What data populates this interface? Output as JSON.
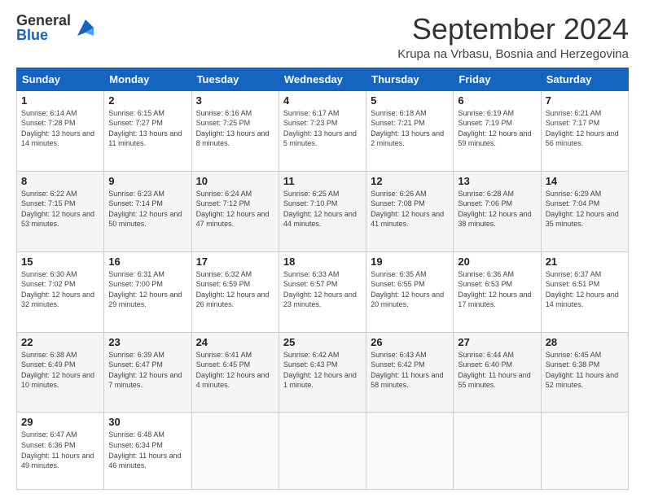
{
  "header": {
    "logo": {
      "general": "General",
      "blue": "Blue"
    },
    "title": "September 2024",
    "location": "Krupa na Vrbasu, Bosnia and Herzegovina"
  },
  "weekdays": [
    "Sunday",
    "Monday",
    "Tuesday",
    "Wednesday",
    "Thursday",
    "Friday",
    "Saturday"
  ],
  "weeks": [
    [
      {
        "day": "1",
        "sunrise": "6:14 AM",
        "sunset": "7:28 PM",
        "daylight": "13 hours and 14 minutes."
      },
      {
        "day": "2",
        "sunrise": "6:15 AM",
        "sunset": "7:27 PM",
        "daylight": "13 hours and 11 minutes."
      },
      {
        "day": "3",
        "sunrise": "6:16 AM",
        "sunset": "7:25 PM",
        "daylight": "13 hours and 8 minutes."
      },
      {
        "day": "4",
        "sunrise": "6:17 AM",
        "sunset": "7:23 PM",
        "daylight": "13 hours and 5 minutes."
      },
      {
        "day": "5",
        "sunrise": "6:18 AM",
        "sunset": "7:21 PM",
        "daylight": "13 hours and 2 minutes."
      },
      {
        "day": "6",
        "sunrise": "6:19 AM",
        "sunset": "7:19 PM",
        "daylight": "12 hours and 59 minutes."
      },
      {
        "day": "7",
        "sunrise": "6:21 AM",
        "sunset": "7:17 PM",
        "daylight": "12 hours and 56 minutes."
      }
    ],
    [
      {
        "day": "8",
        "sunrise": "6:22 AM",
        "sunset": "7:15 PM",
        "daylight": "12 hours and 53 minutes."
      },
      {
        "day": "9",
        "sunrise": "6:23 AM",
        "sunset": "7:14 PM",
        "daylight": "12 hours and 50 minutes."
      },
      {
        "day": "10",
        "sunrise": "6:24 AM",
        "sunset": "7:12 PM",
        "daylight": "12 hours and 47 minutes."
      },
      {
        "day": "11",
        "sunrise": "6:25 AM",
        "sunset": "7:10 PM",
        "daylight": "12 hours and 44 minutes."
      },
      {
        "day": "12",
        "sunrise": "6:26 AM",
        "sunset": "7:08 PM",
        "daylight": "12 hours and 41 minutes."
      },
      {
        "day": "13",
        "sunrise": "6:28 AM",
        "sunset": "7:06 PM",
        "daylight": "12 hours and 38 minutes."
      },
      {
        "day": "14",
        "sunrise": "6:29 AM",
        "sunset": "7:04 PM",
        "daylight": "12 hours and 35 minutes."
      }
    ],
    [
      {
        "day": "15",
        "sunrise": "6:30 AM",
        "sunset": "7:02 PM",
        "daylight": "12 hours and 32 minutes."
      },
      {
        "day": "16",
        "sunrise": "6:31 AM",
        "sunset": "7:00 PM",
        "daylight": "12 hours and 29 minutes."
      },
      {
        "day": "17",
        "sunrise": "6:32 AM",
        "sunset": "6:59 PM",
        "daylight": "12 hours and 26 minutes."
      },
      {
        "day": "18",
        "sunrise": "6:33 AM",
        "sunset": "6:57 PM",
        "daylight": "12 hours and 23 minutes."
      },
      {
        "day": "19",
        "sunrise": "6:35 AM",
        "sunset": "6:55 PM",
        "daylight": "12 hours and 20 minutes."
      },
      {
        "day": "20",
        "sunrise": "6:36 AM",
        "sunset": "6:53 PM",
        "daylight": "12 hours and 17 minutes."
      },
      {
        "day": "21",
        "sunrise": "6:37 AM",
        "sunset": "6:51 PM",
        "daylight": "12 hours and 14 minutes."
      }
    ],
    [
      {
        "day": "22",
        "sunrise": "6:38 AM",
        "sunset": "6:49 PM",
        "daylight": "12 hours and 10 minutes."
      },
      {
        "day": "23",
        "sunrise": "6:39 AM",
        "sunset": "6:47 PM",
        "daylight": "12 hours and 7 minutes."
      },
      {
        "day": "24",
        "sunrise": "6:41 AM",
        "sunset": "6:45 PM",
        "daylight": "12 hours and 4 minutes."
      },
      {
        "day": "25",
        "sunrise": "6:42 AM",
        "sunset": "6:43 PM",
        "daylight": "12 hours and 1 minute."
      },
      {
        "day": "26",
        "sunrise": "6:43 AM",
        "sunset": "6:42 PM",
        "daylight": "11 hours and 58 minutes."
      },
      {
        "day": "27",
        "sunrise": "6:44 AM",
        "sunset": "6:40 PM",
        "daylight": "11 hours and 55 minutes."
      },
      {
        "day": "28",
        "sunrise": "6:45 AM",
        "sunset": "6:38 PM",
        "daylight": "11 hours and 52 minutes."
      }
    ],
    [
      {
        "day": "29",
        "sunrise": "6:47 AM",
        "sunset": "6:36 PM",
        "daylight": "11 hours and 49 minutes."
      },
      {
        "day": "30",
        "sunrise": "6:48 AM",
        "sunset": "6:34 PM",
        "daylight": "11 hours and 46 minutes."
      },
      null,
      null,
      null,
      null,
      null
    ]
  ]
}
